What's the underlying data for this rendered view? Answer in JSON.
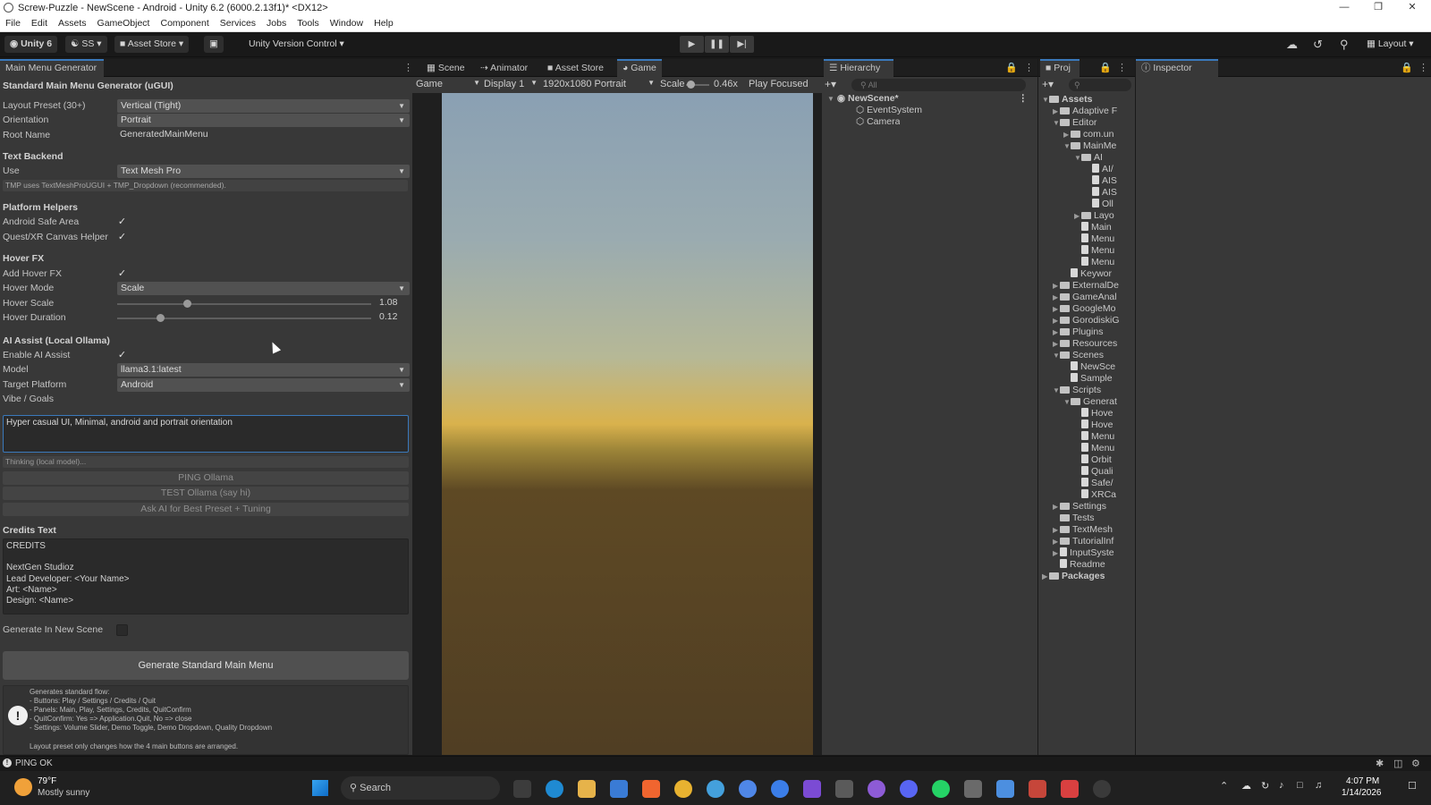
{
  "window": {
    "title": "Screw-Puzzle - NewScene - Android - Unity 6.2 (6000.2.13f1)* <DX12>"
  },
  "menu": [
    "File",
    "Edit",
    "Assets",
    "GameObject",
    "Component",
    "Services",
    "Jobs",
    "Tools",
    "Window",
    "Help"
  ],
  "toolbar": {
    "account": "Unity 6",
    "ss": "SS",
    "asset_store": "Asset Store",
    "version_control": "Unity Version Control",
    "layout": "Layout"
  },
  "left_panel": {
    "tab": "Main Menu Generator",
    "heading": "Standard Main Menu Generator (uGUI)",
    "layout_preset": {
      "label": "Layout Preset (30+)",
      "value": "Vertical (Tight)"
    },
    "orientation": {
      "label": "Orientation",
      "value": "Portrait"
    },
    "root_name": {
      "label": "Root Name",
      "value": "GeneratedMainMenu"
    },
    "text_backend": {
      "header": "Text Backend",
      "label": "Use",
      "value": "Text Mesh Pro",
      "note": "TMP uses TextMeshProUGUI + TMP_Dropdown (recommended)."
    },
    "platform": {
      "header": "Platform Helpers",
      "safe_area": "Android Safe Area",
      "xr": "Quest/XR Canvas Helper"
    },
    "hover": {
      "header": "Hover FX",
      "add": "Add Hover FX",
      "mode_label": "Hover Mode",
      "mode_value": "Scale",
      "scale_label": "Hover Scale",
      "scale_value": "1.08",
      "duration_label": "Hover Duration",
      "duration_value": "0.12"
    },
    "ai": {
      "header": "AI Assist (Local Ollama)",
      "enable": "Enable AI Assist",
      "model_label": "Model",
      "model_value": "llama3.1:latest",
      "platform_label": "Target Platform",
      "platform_value": "Android",
      "vibe_label": "Vibe / Goals",
      "vibe_value": "Hyper casual UI, Minimal, android and portrait orientation",
      "thinking": "Thinking (local model)...",
      "ping": "PING Ollama",
      "test": "TEST Ollama (say hi)",
      "ask": "Ask AI for Best Preset + Tuning"
    },
    "credits": {
      "header": "Credits Text",
      "lines": [
        "CREDITS",
        "",
        "NextGen Studioz",
        "Lead Developer: <Your Name>",
        "Art: <Name>",
        "Design: <Name>"
      ]
    },
    "generate_new_scene": "Generate In New Scene",
    "generate_button": "Generate Standard Main Menu",
    "help": {
      "lines": [
        "Generates standard flow:",
        "- Buttons: Play / Settings / Credits / Quit",
        "- Panels: Main, Play, Settings, Credits, QuitConfirm",
        "- QuitConfirm: Yes => Application.Quit, No => close",
        "- Settings: Volume Slider, Demo Toggle, Demo Dropdown, Quality Dropdown"
      ],
      "footer": "Layout preset only changes how the 4 main buttons are arranged."
    }
  },
  "game_panel": {
    "tabs": [
      "Scene",
      "Animator",
      "Asset Store",
      "Game"
    ],
    "game_label": "Game",
    "display": "Display 1",
    "resolution": "1920x1080 Portrait",
    "scale_label": "Scale",
    "scale_value": "0.46x",
    "play_focused": "Play Focused"
  },
  "hierarchy": {
    "tab": "Hierarchy",
    "search": "All",
    "scene": "NewScene*",
    "items": [
      "EventSystem",
      "Camera"
    ]
  },
  "project": {
    "tab": "Proj",
    "items": [
      {
        "t": "Assets",
        "d": 0,
        "f": 1,
        "c": "v"
      },
      {
        "t": "Adaptive F",
        "d": 1,
        "f": 1,
        "c": ">"
      },
      {
        "t": "Editor",
        "d": 1,
        "f": 1,
        "c": "v"
      },
      {
        "t": "com.un",
        "d": 2,
        "f": 1,
        "c": ">"
      },
      {
        "t": "MainMe",
        "d": 2,
        "f": 1,
        "c": "v"
      },
      {
        "t": "AI",
        "d": 3,
        "f": 1,
        "c": "v"
      },
      {
        "t": "AI/",
        "d": 4,
        "f": 0,
        "c": ""
      },
      {
        "t": "AIS",
        "d": 4,
        "f": 0,
        "c": ""
      },
      {
        "t": "AIS",
        "d": 4,
        "f": 0,
        "c": ""
      },
      {
        "t": "Oll",
        "d": 4,
        "f": 0,
        "c": ""
      },
      {
        "t": "Layo",
        "d": 3,
        "f": 1,
        "c": ">"
      },
      {
        "t": "Main",
        "d": 3,
        "f": 0,
        "c": ""
      },
      {
        "t": "Menu",
        "d": 3,
        "f": 0,
        "c": ""
      },
      {
        "t": "Menu",
        "d": 3,
        "f": 0,
        "c": ""
      },
      {
        "t": "Menu",
        "d": 3,
        "f": 0,
        "c": ""
      },
      {
        "t": "Keywor",
        "d": 2,
        "f": 0,
        "c": ""
      },
      {
        "t": "ExternalDe",
        "d": 1,
        "f": 1,
        "c": ">"
      },
      {
        "t": "GameAnal",
        "d": 1,
        "f": 1,
        "c": ">"
      },
      {
        "t": "GoogleMo",
        "d": 1,
        "f": 1,
        "c": ">"
      },
      {
        "t": "GorodiskiG",
        "d": 1,
        "f": 1,
        "c": ">"
      },
      {
        "t": "Plugins",
        "d": 1,
        "f": 1,
        "c": ">"
      },
      {
        "t": "Resources",
        "d": 1,
        "f": 1,
        "c": ">"
      },
      {
        "t": "Scenes",
        "d": 1,
        "f": 1,
        "c": "v"
      },
      {
        "t": "NewSce",
        "d": 2,
        "f": 0,
        "c": ""
      },
      {
        "t": "Sample",
        "d": 2,
        "f": 0,
        "c": ""
      },
      {
        "t": "Scripts",
        "d": 1,
        "f": 1,
        "c": "v"
      },
      {
        "t": "Generat",
        "d": 2,
        "f": 1,
        "c": "v"
      },
      {
        "t": "Hove",
        "d": 3,
        "f": 0,
        "c": ""
      },
      {
        "t": "Hove",
        "d": 3,
        "f": 0,
        "c": ""
      },
      {
        "t": "Menu",
        "d": 3,
        "f": 0,
        "c": ""
      },
      {
        "t": "Menu",
        "d": 3,
        "f": 0,
        "c": ""
      },
      {
        "t": "Orbit",
        "d": 3,
        "f": 0,
        "c": ""
      },
      {
        "t": "Quali",
        "d": 3,
        "f": 0,
        "c": ""
      },
      {
        "t": "Safe/",
        "d": 3,
        "f": 0,
        "c": ""
      },
      {
        "t": "XRCa",
        "d": 3,
        "f": 0,
        "c": ""
      },
      {
        "t": "Settings",
        "d": 1,
        "f": 1,
        "c": ">"
      },
      {
        "t": "Tests",
        "d": 1,
        "f": 1,
        "c": ""
      },
      {
        "t": "TextMesh",
        "d": 1,
        "f": 1,
        "c": ">"
      },
      {
        "t": "TutorialInf",
        "d": 1,
        "f": 1,
        "c": ">"
      },
      {
        "t": "InputSyste",
        "d": 1,
        "f": 0,
        "c": ">"
      },
      {
        "t": "Readme",
        "d": 1,
        "f": 0,
        "c": ""
      },
      {
        "t": "Packages",
        "d": 0,
        "f": 1,
        "c": ">"
      }
    ]
  },
  "inspector": {
    "tab": "Inspector"
  },
  "status": {
    "text": "PING OK"
  },
  "taskbar": {
    "temp": "79°F",
    "weather": "Mostly sunny",
    "search": "Search",
    "time": "4:07 PM",
    "date": "1/14/2026"
  }
}
